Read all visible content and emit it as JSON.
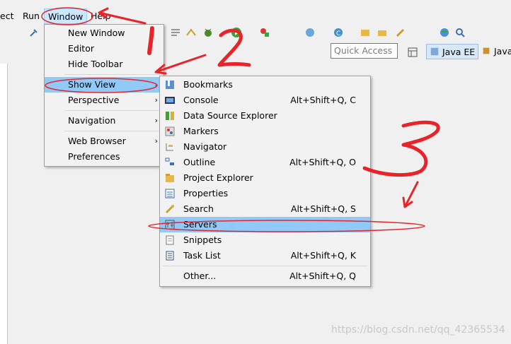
{
  "menubar": {
    "items": [
      "ect",
      "Run",
      "Window",
      "Help"
    ]
  },
  "quick_access": {
    "placeholder": "Quick Access"
  },
  "perspectives": [
    "Java EE",
    "Java"
  ],
  "window_menu": {
    "items": [
      {
        "label": "New Window"
      },
      {
        "label": "Editor"
      },
      {
        "label": "Hide Toolbar"
      },
      {
        "label": "Show View",
        "submenu": true
      },
      {
        "label": "Perspective",
        "submenu": true
      },
      {
        "label": "Navigation",
        "submenu": true
      },
      {
        "label": "Web Browser",
        "submenu": true
      },
      {
        "label": "Preferences"
      }
    ]
  },
  "show_view_menu": {
    "items": [
      {
        "label": "Bookmarks",
        "shortcut": "",
        "icon": "bookmarks-icon"
      },
      {
        "label": "Console",
        "shortcut": "Alt+Shift+Q, C",
        "icon": "console-icon"
      },
      {
        "label": "Data Source Explorer",
        "shortcut": "",
        "icon": "data-source-icon"
      },
      {
        "label": "Markers",
        "shortcut": "",
        "icon": "markers-icon"
      },
      {
        "label": "Navigator",
        "shortcut": "",
        "icon": "navigator-icon"
      },
      {
        "label": "Outline",
        "shortcut": "Alt+Shift+Q, O",
        "icon": "outline-icon"
      },
      {
        "label": "Project Explorer",
        "shortcut": "",
        "icon": "project-explorer-icon"
      },
      {
        "label": "Properties",
        "shortcut": "",
        "icon": "properties-icon"
      },
      {
        "label": "Search",
        "shortcut": "Alt+Shift+Q, S",
        "icon": "search-icon"
      },
      {
        "label": "Servers",
        "shortcut": "",
        "icon": "servers-icon"
      },
      {
        "label": "Snippets",
        "shortcut": "",
        "icon": "snippets-icon"
      },
      {
        "label": "Task List",
        "shortcut": "Alt+Shift+Q, K",
        "icon": "task-list-icon"
      },
      {
        "label": "Other...",
        "shortcut": "Alt+Shift+Q, Q",
        "icon": ""
      }
    ]
  },
  "annotations": [
    "1",
    "2",
    "3"
  ],
  "watermark": "https://blog.csdn.net/qq_42365534",
  "colors": {
    "highlight": "#91c9f7",
    "annotation": "#e8232a",
    "menubar_active": "#cce8ff"
  }
}
